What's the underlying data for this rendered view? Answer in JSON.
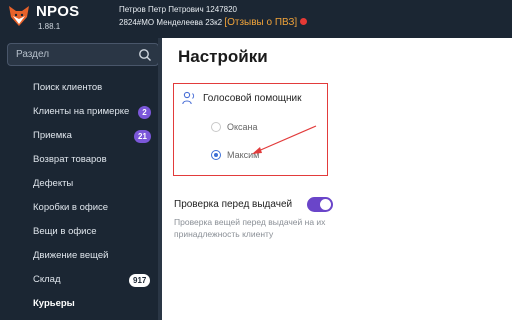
{
  "header": {
    "brand": "NPOS",
    "version": "1.88.1",
    "user_name": "Петров Петр Петрович 1247820",
    "office": "2824#МО Менделеева 23к2",
    "reviews_link": "[Отзывы о ПВЗ]"
  },
  "sidebar": {
    "search_placeholder": "Раздел",
    "items": [
      {
        "label": "Поиск клиентов"
      },
      {
        "label": "Клиенты на примерке",
        "badge": "2"
      },
      {
        "label": "Приемка",
        "badge": "21"
      },
      {
        "label": "Возврат товаров"
      },
      {
        "label": "Дефекты"
      },
      {
        "label": "Коробки в офисе"
      },
      {
        "label": "Вещи в офисе"
      },
      {
        "label": "Движение вещей"
      },
      {
        "label": "Склад",
        "badge": "917"
      },
      {
        "label": "Курьеры"
      }
    ]
  },
  "main": {
    "title": "Настройки",
    "voice_assistant": {
      "title": "Голосовой помощник",
      "options": [
        {
          "label": "Оксана",
          "selected": false
        },
        {
          "label": "Максим",
          "selected": true
        }
      ]
    },
    "check_before_issue": {
      "title": "Проверка перед выдачей",
      "enabled": true,
      "description": "Проверка вещей перед выдачей на их принадлежность клиенту"
    }
  },
  "colors": {
    "sidebar_bg": "#1b2633",
    "accent_purple": "#7b57d9",
    "reviews_link": "#f0a33a",
    "highlight": "#e23b3b"
  }
}
